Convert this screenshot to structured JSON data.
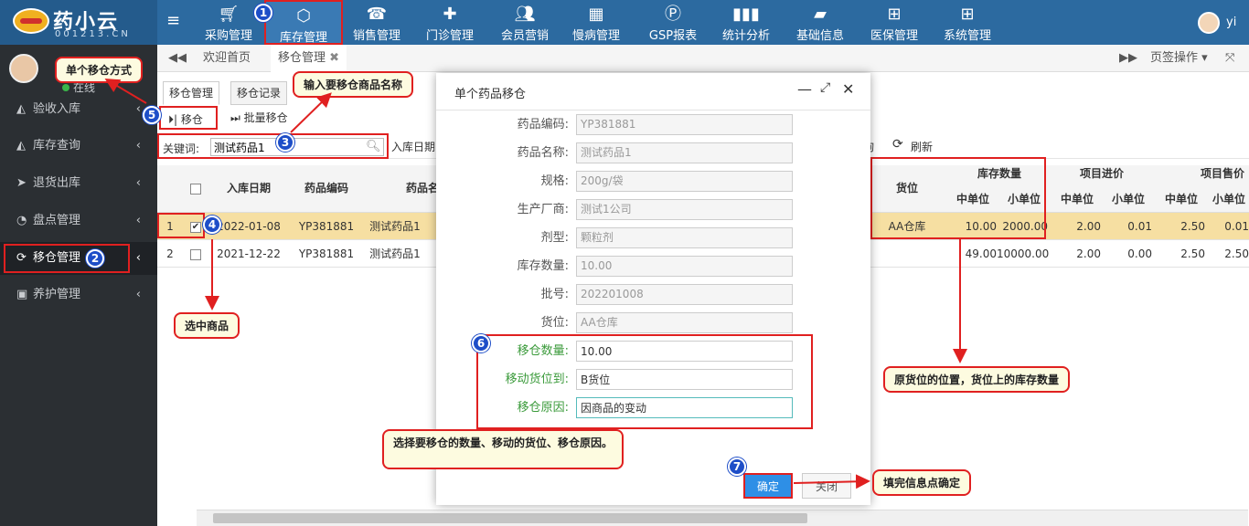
{
  "brand": {
    "name": "药小云",
    "domain": "001213.CN"
  },
  "topnav": [
    {
      "label": "采购管理",
      "icon": "cart-icon"
    },
    {
      "label": "库存管理",
      "icon": "cube-icon"
    },
    {
      "label": "销售管理",
      "icon": "register-icon"
    },
    {
      "label": "门诊管理",
      "icon": "medkit-icon"
    },
    {
      "label": "会员营销",
      "icon": "users-icon"
    },
    {
      "label": "慢病管理",
      "icon": "building-icon"
    },
    {
      "label": "GSP报表",
      "icon": "parking-icon"
    },
    {
      "label": "统计分析",
      "icon": "bar-chart-icon"
    },
    {
      "label": "基础信息",
      "icon": "book-icon"
    },
    {
      "label": "医保管理",
      "icon": "windows-icon"
    },
    {
      "label": "系统管理",
      "icon": "windows-icon"
    }
  ],
  "user": {
    "name": "yi",
    "status": "在线"
  },
  "sidebar": [
    {
      "label": "验收入库"
    },
    {
      "label": "库存查询"
    },
    {
      "label": "退货出库"
    },
    {
      "label": "盘点管理"
    },
    {
      "label": "移仓管理"
    },
    {
      "label": "养护管理"
    }
  ],
  "tabs": {
    "home": "欢迎首页",
    "active": "移仓管理",
    "page_ops": "页签操作"
  },
  "subtabs": {
    "manage": "移仓管理",
    "records": "移仓记录"
  },
  "toolbar": {
    "move": "移仓",
    "batch_move": "批量移仓",
    "refresh": "刷新",
    "query": "询"
  },
  "search": {
    "label": "关键词:",
    "value": "测试药品1",
    "date_label": "入库日期"
  },
  "table": {
    "headers": {
      "in_date": "入库日期",
      "code": "药品编码",
      "name": "药品名",
      "location": "货位",
      "stock": "库存数量",
      "purchase": "项目进价",
      "sale": "项目售价",
      "mid": "中单位",
      "small": "小单位"
    },
    "rows": [
      {
        "no": "1",
        "in_date": "2022-01-08",
        "code": "YP381881",
        "name": "测试药品1",
        "location": "AA仓库",
        "stock_mid": "10.00",
        "stock_small": "2000.00",
        "p_mid": "2.00",
        "p_small": "0.01",
        "s_mid": "2.50",
        "s_small": "0.01"
      },
      {
        "no": "2",
        "in_date": "2021-12-22",
        "code": "YP381881",
        "name": "测试药品1",
        "location": "",
        "stock_mid": "49.00",
        "stock_small": "10000.00",
        "p_mid": "2.00",
        "p_small": "0.00",
        "s_mid": "2.50",
        "s_small": "2.50"
      }
    ]
  },
  "dialog": {
    "title": "单个药品移仓",
    "fields": [
      {
        "label": "药品编码:",
        "value": "YP381881"
      },
      {
        "label": "药品名称:",
        "value": "测试药品1"
      },
      {
        "label": "规格:",
        "value": "200g/袋"
      },
      {
        "label": "生产厂商:",
        "value": "测试1公司"
      },
      {
        "label": "剂型:",
        "value": "颗粒剂"
      },
      {
        "label": "库存数量:",
        "value": "10.00"
      },
      {
        "label": "批号:",
        "value": "202201008"
      },
      {
        "label": "货位:",
        "value": "AA仓库"
      }
    ],
    "edit_fields": [
      {
        "label": "移仓数量:",
        "value": "10.00"
      },
      {
        "label": "移动货位到:",
        "value": "B货位"
      },
      {
        "label": "移仓原因:",
        "value": "因商品的变动"
      }
    ],
    "ok": "确定",
    "close": "关闭"
  },
  "annotations": {
    "single_mode": "单个移仓方式",
    "enter_name": "输入要移仓商品名称",
    "select_goods": "选中商品",
    "orig_location": "原货位的位置，货位上的库存数量",
    "choose_fields": "选择要移仓的数量、移动的货位、移仓原因。",
    "confirm": "填完信息点确定"
  },
  "badges": [
    "1",
    "2",
    "3",
    "4",
    "5",
    "6",
    "7"
  ]
}
